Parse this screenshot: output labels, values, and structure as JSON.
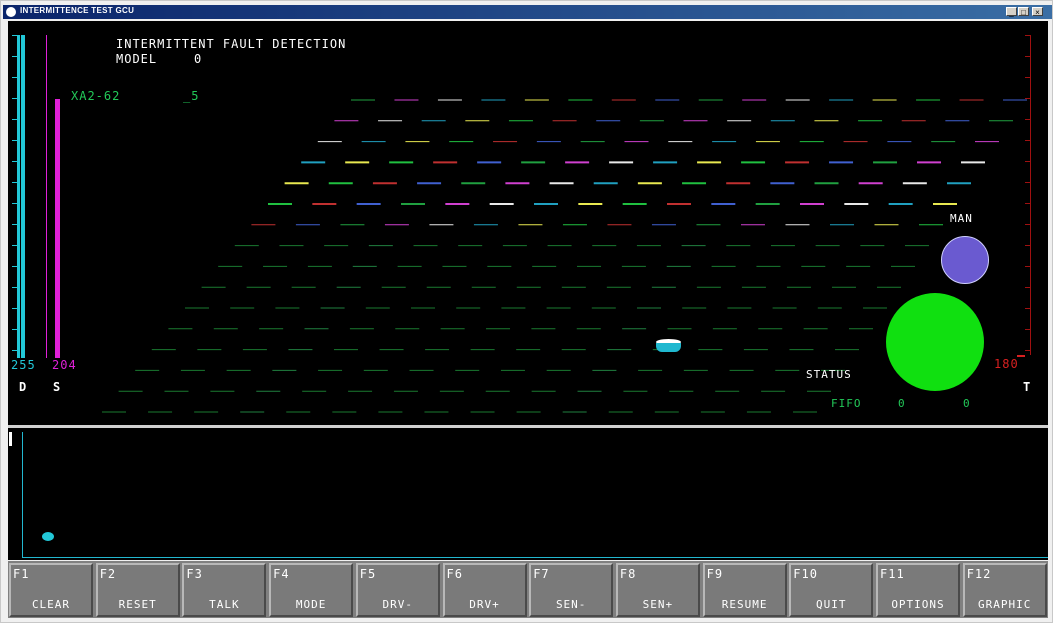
{
  "window": {
    "title": "INTERMITTENCE TEST    GCU"
  },
  "header": {
    "line1": "INTERMITTENT FAULT DETECTION",
    "model_label": "MODEL",
    "model_value": "0"
  },
  "channel": {
    "name": "XA2-62",
    "value": "_5"
  },
  "gauges": {
    "d": {
      "value": "255",
      "letter": "D",
      "color": "#22c8d8",
      "level": 1.0
    },
    "s": {
      "value": "204",
      "letter": "S",
      "color": "#e020d8",
      "level": 0.8
    },
    "t": {
      "value": "180",
      "letter": "T",
      "color": "#d82020"
    }
  },
  "indicators": {
    "man_label": "MAN",
    "status_label": "STATUS",
    "man_color": "#6a5ad0",
    "status_color": "#10e010"
  },
  "fifo": {
    "label": "FIFO",
    "value1": "0",
    "value2": "0"
  },
  "fkeys": [
    {
      "key": "F1",
      "label": "CLEAR"
    },
    {
      "key": "F2",
      "label": "RESET"
    },
    {
      "key": "F3",
      "label": "TALK"
    },
    {
      "key": "F4",
      "label": "MODE"
    },
    {
      "key": "F5",
      "label": "DRV-"
    },
    {
      "key": "F6",
      "label": "DRV+"
    },
    {
      "key": "F7",
      "label": "SEN-"
    },
    {
      "key": "F8",
      "label": "SEN+"
    },
    {
      "key": "F9",
      "label": "RESUME"
    },
    {
      "key": "F10",
      "label": "QUIT"
    },
    {
      "key": "F11",
      "label": "OPTIONS"
    },
    {
      "key": "F12",
      "label": "GRAPHIC"
    }
  ],
  "icons": {
    "window_icon": "app-icon",
    "minimize": "minimize-icon",
    "maximize": "maximize-icon",
    "close": "close-icon"
  }
}
